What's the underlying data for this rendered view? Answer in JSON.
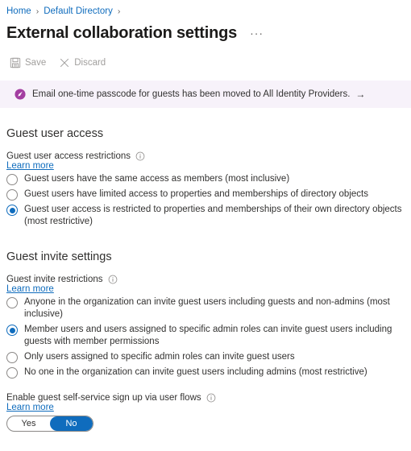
{
  "breadcrumb": {
    "items": [
      {
        "label": "Home"
      },
      {
        "label": "Default Directory"
      }
    ],
    "separator": "›"
  },
  "header": {
    "title": "External collaboration settings",
    "more_label": "···"
  },
  "toolbar": {
    "save_label": "Save",
    "discard_label": "Discard"
  },
  "banner": {
    "icon": "megaphone-icon",
    "text": "Email one-time passcode for guests has been moved to All Identity Providers.",
    "arrow": "→"
  },
  "guest_user_access": {
    "heading": "Guest user access",
    "field_label": "Guest user access restrictions",
    "info_icon": "info-icon",
    "learn_more": "Learn more",
    "options": [
      {
        "label": "Guest users have the same access as members (most inclusive)",
        "selected": false
      },
      {
        "label": "Guest users have limited access to properties and memberships of directory objects",
        "selected": false
      },
      {
        "label": "Guest user access is restricted to properties and memberships of their own directory objects (most restrictive)",
        "selected": true
      }
    ]
  },
  "guest_invite_settings": {
    "heading": "Guest invite settings",
    "field_label": "Guest invite restrictions",
    "info_icon": "info-icon",
    "learn_more": "Learn more",
    "options": [
      {
        "label": "Anyone in the organization can invite guest users including guests and non-admins (most inclusive)",
        "selected": false
      },
      {
        "label": "Member users and users assigned to specific admin roles can invite guest users including guests with member permissions",
        "selected": true
      },
      {
        "label": "Only users assigned to specific admin roles can invite guest users",
        "selected": false
      },
      {
        "label": "No one in the organization can invite guest users including admins (most restrictive)",
        "selected": false
      }
    ]
  },
  "self_service": {
    "field_label": "Enable guest self-service sign up via user flows",
    "info_icon": "info-icon",
    "learn_more": "Learn more",
    "toggle": {
      "yes_label": "Yes",
      "no_label": "No",
      "value": "No"
    }
  },
  "colors": {
    "accent": "#0f6cbd",
    "link": "#0f6cbd",
    "banner_bg": "#f7f2fa",
    "banner_icon": "#a33ea1",
    "text": "#323130",
    "disabled": "#a19f9d"
  }
}
